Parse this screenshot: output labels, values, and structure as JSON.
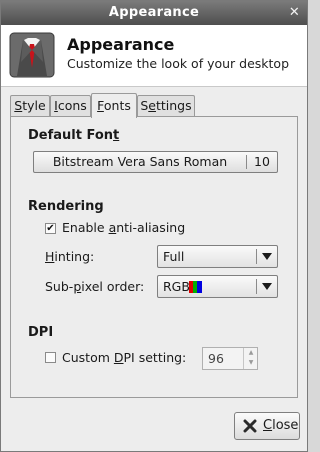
{
  "window": {
    "title": "Appearance",
    "titlebar_close_glyph": "✕"
  },
  "header": {
    "icon": "suit-tie-icon",
    "title": "Appearance",
    "subtitle": "Customize the look of your desktop"
  },
  "tabs": [
    {
      "label_pre": "",
      "mnemonic": "S",
      "label_post": "tyle",
      "active": false
    },
    {
      "label_pre": "",
      "mnemonic": "I",
      "label_post": "cons",
      "active": false
    },
    {
      "label_pre": "",
      "mnemonic": "F",
      "label_post": "onts",
      "active": true
    },
    {
      "label_pre": "S",
      "mnemonic": "e",
      "label_post": "ttings",
      "active": false
    }
  ],
  "default_font": {
    "title_pre": "Default Fon",
    "title_mnemonic": "t",
    "font_name": "Bitstream Vera Sans Roman",
    "font_size": "10"
  },
  "rendering": {
    "title": "Rendering",
    "antialias": {
      "checked": true,
      "check_glyph": "✔",
      "label_pre": "Enable ",
      "label_mnemonic": "a",
      "label_post": "nti-aliasing"
    },
    "hinting": {
      "label_pre": "",
      "label_mnemonic": "H",
      "label_post": "inting:",
      "value": "Full"
    },
    "subpixel": {
      "label_pre": "Sub-",
      "label_mnemonic": "p",
      "label_post": "ixel order:",
      "value": "RGB",
      "icon": "rgb-stripes-icon"
    }
  },
  "dpi": {
    "title": "DPI",
    "custom": {
      "checked": false,
      "label_pre": "Custom ",
      "label_mnemonic": "D",
      "label_post": "PI setting:",
      "value": "96",
      "up_glyph": "▲",
      "down_glyph": "▼"
    }
  },
  "buttons": {
    "close": {
      "mnemonic": "C",
      "label_post": "lose",
      "icon": "close-x-icon"
    }
  },
  "colors": {
    "titlebar": "#5e5e5e",
    "red": "#e00000",
    "green": "#00b000",
    "blue": "#0000e0"
  }
}
